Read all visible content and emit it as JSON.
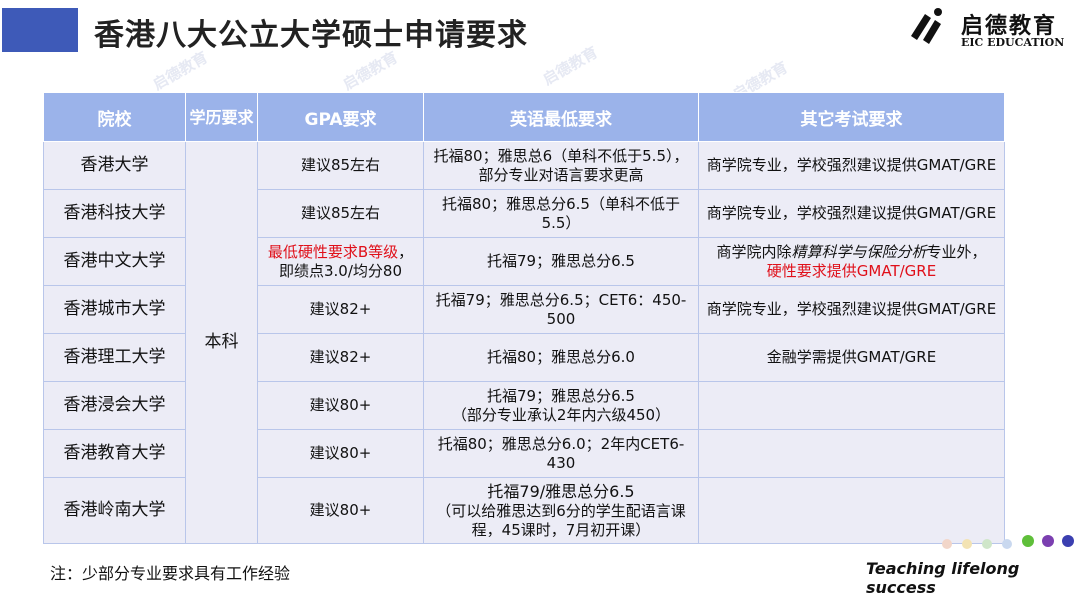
{
  "title": "香港八大公立大学硕士申请要求",
  "logo": {
    "cn": "启德教育",
    "en": "EIC EDUCATION"
  },
  "table": {
    "headers": [
      "院校",
      "学历要求",
      "GPA要求",
      "英语最低要求",
      "其它考试要求"
    ],
    "degree": "本科",
    "rows": [
      {
        "school": "香港大学",
        "gpa": "建议85左右",
        "english": "托福80；雅思总6（单科不低于5.5），部分专业对语言要求更高",
        "other": "商学院专业，学校强烈建议提供GMAT/GRE"
      },
      {
        "school": "香港科技大学",
        "gpa": "建议85左右",
        "english": "托福80；雅思总分6.5（单科不低于5.5）",
        "other": "商学院专业，学校强烈建议提供GMAT/GRE"
      },
      {
        "school": "香港中文大学",
        "gpa_red": "最低硬性要求B等级",
        "gpa_rest": "，即绩点3.0/均分80",
        "english": "托福79；雅思总分6.5",
        "other_a": "商学院内除",
        "other_italic": "精算科学与保险分析",
        "other_b": "专业外，",
        "other_red": "硬性要求提供GMAT/GRE"
      },
      {
        "school": "香港城市大学",
        "gpa": "建议82+",
        "english": "托福79；雅思总分6.5；CET6：450-500",
        "other": "商学院专业，学校强烈建议提供GMAT/GRE"
      },
      {
        "school": "香港理工大学",
        "gpa": "建议82+",
        "english": "托福80；雅思总分6.0",
        "other": "金融学需提供GMAT/GRE"
      },
      {
        "school": "香港浸会大学",
        "gpa": "建议80+",
        "english_1": "托福79；雅思总分6.5",
        "english_2": "（部分专业承认2年内六级450）",
        "other": ""
      },
      {
        "school": "香港教育大学",
        "gpa": "建议80+",
        "english": "托福80；雅思总分6.0；2年内CET6-430",
        "other": ""
      },
      {
        "school": "香港岭南大学",
        "gpa": "建议80+",
        "english_1": "托福79/雅思总分6.5",
        "english_2": "（可以给雅思达到6分的学生配语言课程，45课时，7月初开课）",
        "other": ""
      }
    ]
  },
  "footer": {
    "note": "注：少部分专业要求具有工作经验",
    "slogan": "Teaching lifelong success"
  },
  "watermark": "启德教育",
  "colors": {
    "title_bar": "#3e5ab8",
    "header_bg": "#9bb3ea",
    "cell_bg": "#ececf6",
    "red": "#e0101a"
  },
  "dot_colors": [
    "#f2d6c9",
    "#f3e3b3",
    "#cfe6c9",
    "#c9d8ef",
    "#5fbf3a",
    "#7b3fb0",
    "#3b3fb0"
  ]
}
